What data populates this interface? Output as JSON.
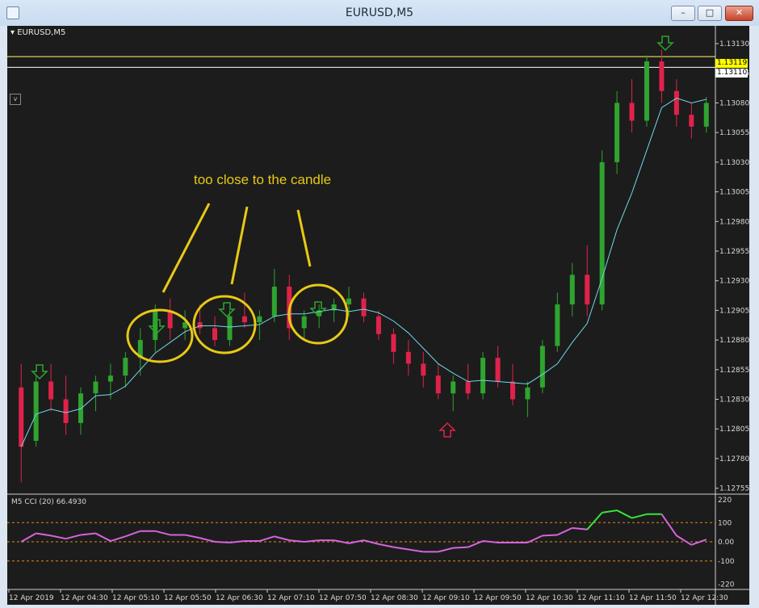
{
  "window": {
    "title": "EURUSD,M5",
    "min_label": "–",
    "max_label": "□",
    "close_label": "✕"
  },
  "chart": {
    "symbol_label": "EURUSD,M5",
    "v_button": "v",
    "annotation": "too close to the candle",
    "price_tags": {
      "line_yellow": "1.13119",
      "line_white": "1.13110"
    },
    "price_axis": [
      "1.13130",
      "1.13105",
      "1.13080",
      "1.13055",
      "1.13030",
      "1.13005",
      "1.12980",
      "1.12955",
      "1.12930",
      "1.12905",
      "1.12880",
      "1.12855",
      "1.12830",
      "1.12805",
      "1.12780",
      "1.12755"
    ],
    "cci_label": "M5 CCI (20) 66.4930",
    "cci_axis": [
      "220",
      "100",
      "0.00",
      "-100",
      "-220"
    ],
    "time_axis": [
      "12 Apr 2019",
      "12 Apr 04:30",
      "12 Apr 05:10",
      "12 Apr 05:50",
      "12 Apr 06:30",
      "12 Apr 07:10",
      "12 Apr 07:50",
      "12 Apr 08:30",
      "12 Apr 09:10",
      "12 Apr 09:50",
      "12 Apr 10:30",
      "12 Apr 11:10",
      "12 Apr 11:50",
      "12 Apr 12:30"
    ],
    "colors": {
      "bull": "#2fa42f",
      "bear": "#e0224a",
      "ma": "#6fd9e8",
      "cci_up": "#39e339",
      "cci_mid": "#d663dd",
      "cci_down": "#ff1a1a",
      "yellow_line": "#ffff66",
      "levels": "#e08a1f",
      "highlight": "#e7c915"
    }
  },
  "chart_data": {
    "type": "candlestick",
    "candles": [
      [
        1.1284,
        1.1286,
        1.1276,
        1.1279
      ],
      [
        1.12795,
        1.1285,
        1.1279,
        1.12845
      ],
      [
        1.12845,
        1.1286,
        1.1282,
        1.1283
      ],
      [
        1.1283,
        1.1285,
        1.128,
        1.1281
      ],
      [
        1.1281,
        1.1284,
        1.128,
        1.12835
      ],
      [
        1.12835,
        1.1285,
        1.1282,
        1.12845
      ],
      [
        1.12845,
        1.1286,
        1.1283,
        1.1285
      ],
      [
        1.1285,
        1.1287,
        1.1284,
        1.12865
      ],
      [
        1.12865,
        1.1289,
        1.1285,
        1.1288
      ],
      [
        1.1288,
        1.1291,
        1.1287,
        1.12905
      ],
      [
        1.12905,
        1.12915,
        1.1288,
        1.1289
      ],
      [
        1.1289,
        1.12905,
        1.1288,
        1.12895
      ],
      [
        1.12895,
        1.1291,
        1.12885,
        1.1289
      ],
      [
        1.1289,
        1.129,
        1.12875,
        1.1288
      ],
      [
        1.1288,
        1.12905,
        1.12875,
        1.129
      ],
      [
        1.129,
        1.1292,
        1.1289,
        1.12895
      ],
      [
        1.12895,
        1.12905,
        1.1288,
        1.129
      ],
      [
        1.129,
        1.1294,
        1.12895,
        1.12925
      ],
      [
        1.12925,
        1.12935,
        1.1288,
        1.1289
      ],
      [
        1.1289,
        1.12905,
        1.1288,
        1.129
      ],
      [
        1.129,
        1.1291,
        1.1289,
        1.12905
      ],
      [
        1.12905,
        1.12915,
        1.12895,
        1.1291
      ],
      [
        1.1291,
        1.12925,
        1.129,
        1.12915
      ],
      [
        1.12915,
        1.1292,
        1.12895,
        1.129
      ],
      [
        1.129,
        1.12905,
        1.1288,
        1.12885
      ],
      [
        1.12885,
        1.1289,
        1.1286,
        1.1287
      ],
      [
        1.1287,
        1.1288,
        1.1285,
        1.1286
      ],
      [
        1.1286,
        1.1287,
        1.1284,
        1.1285
      ],
      [
        1.1285,
        1.1286,
        1.1283,
        1.12835
      ],
      [
        1.12835,
        1.1285,
        1.1282,
        1.12845
      ],
      [
        1.12845,
        1.1286,
        1.1283,
        1.12835
      ],
      [
        1.12835,
        1.1287,
        1.1283,
        1.12865
      ],
      [
        1.12865,
        1.12875,
        1.1284,
        1.12845
      ],
      [
        1.12845,
        1.1286,
        1.12825,
        1.1283
      ],
      [
        1.1283,
        1.12845,
        1.12815,
        1.1284
      ],
      [
        1.1284,
        1.1288,
        1.12835,
        1.12875
      ],
      [
        1.12875,
        1.1292,
        1.1287,
        1.1291
      ],
      [
        1.1291,
        1.12945,
        1.129,
        1.12935
      ],
      [
        1.12935,
        1.1296,
        1.129,
        1.1291
      ],
      [
        1.1291,
        1.1304,
        1.12905,
        1.1303
      ],
      [
        1.1303,
        1.1309,
        1.1302,
        1.1308
      ],
      [
        1.1308,
        1.131,
        1.13055,
        1.13065
      ],
      [
        1.13065,
        1.1312,
        1.1306,
        1.13115
      ],
      [
        1.13115,
        1.13125,
        1.1308,
        1.1309
      ],
      [
        1.1309,
        1.131,
        1.1306,
        1.1307
      ],
      [
        1.1307,
        1.1308,
        1.1305,
        1.1306
      ],
      [
        1.1306,
        1.13085,
        1.13055,
        1.1308
      ]
    ],
    "price_range": [
      1.1275,
      1.13145
    ],
    "cci_range": [
      -240,
      240
    ]
  }
}
